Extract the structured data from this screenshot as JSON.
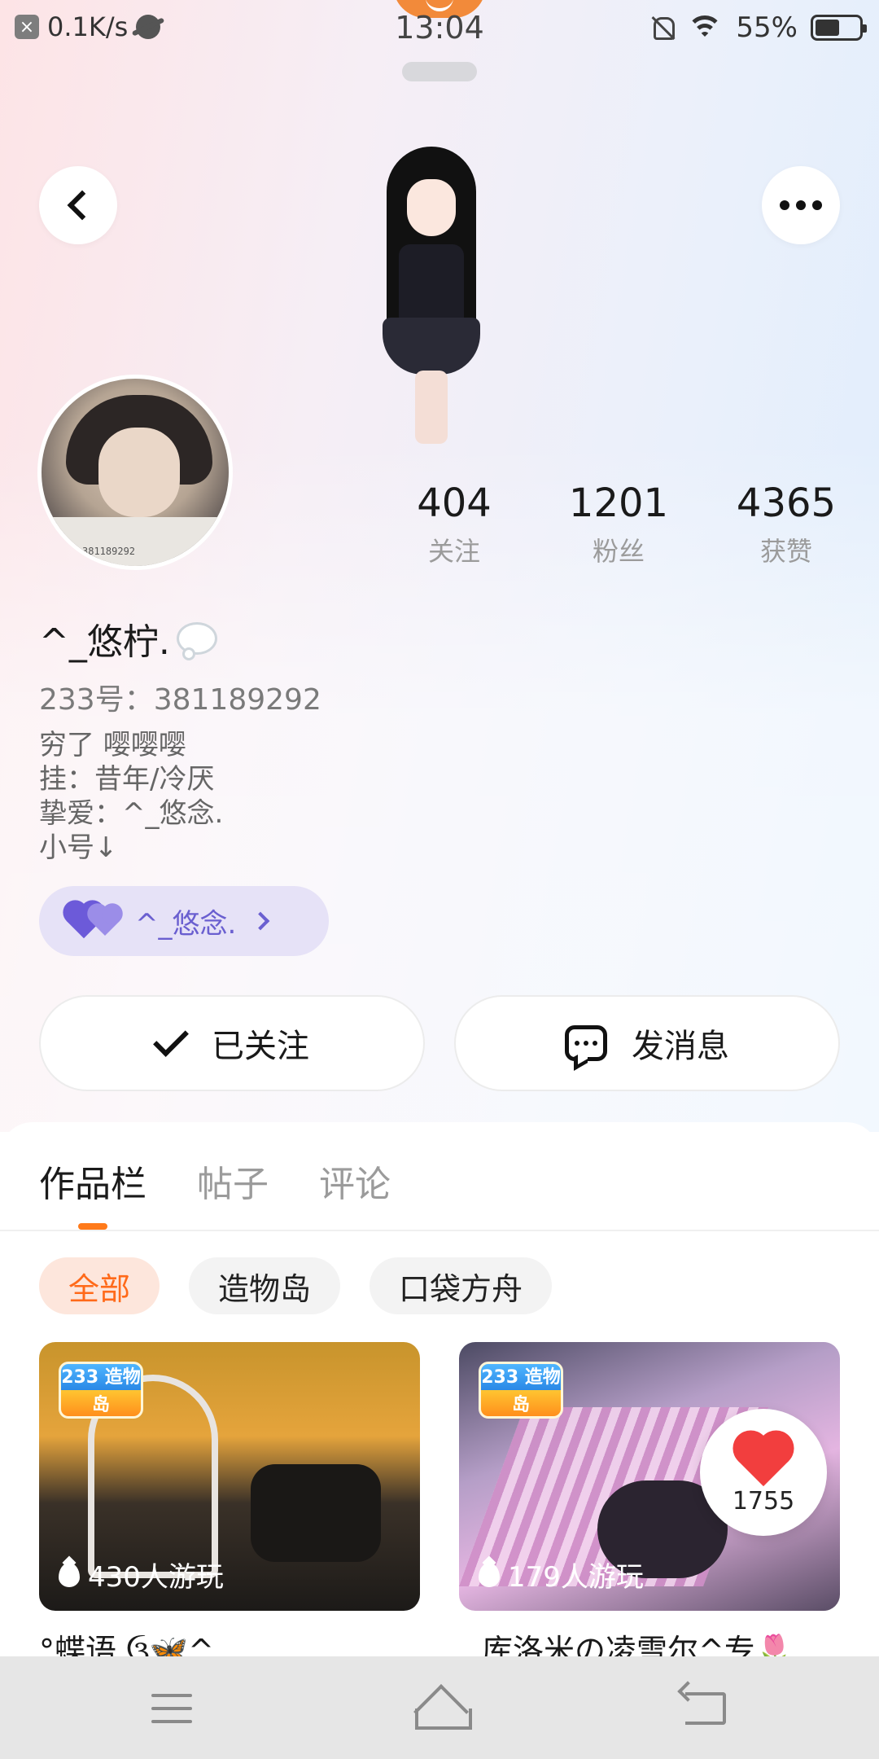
{
  "status_bar": {
    "net_speed": "0.1K/s",
    "time": "13:04",
    "battery": "55%",
    "battery_level": 0.55
  },
  "header": {
    "back_icon": "chevron-left-icon",
    "more_icon": "more-dots-icon"
  },
  "profile": {
    "stats": [
      {
        "value": "404",
        "label": "关注"
      },
      {
        "value": "1201",
        "label": "粉丝"
      },
      {
        "value": "4365",
        "label": "获赞"
      }
    ],
    "nickname": "^_悠柠.",
    "id_line": "233号：381189292",
    "bio": [
      "穷了 嘤嘤嘤",
      "挂：昔年/冷厌",
      "挚爱：^_悠念.",
      "小号↓"
    ],
    "avatar_caption": "381189292",
    "linked_user": "^_悠念."
  },
  "actions": {
    "followed_label": "已关注",
    "message_label": "发消息"
  },
  "tabs": [
    {
      "label": "作品栏",
      "active": true
    },
    {
      "label": "帖子",
      "active": false
    },
    {
      "label": "评论",
      "active": false
    }
  ],
  "filters": [
    {
      "label": "全部",
      "active": true
    },
    {
      "label": "造物岛",
      "active": false
    },
    {
      "label": "口袋方舟",
      "active": false
    }
  ],
  "games": [
    {
      "logo": "233 造物岛",
      "plays": "430人游玩",
      "title": "°蝶语.ઉ🦋^"
    },
    {
      "logo": "233 造物岛",
      "plays": "179人游玩",
      "title": "库洛米の凌雪尔^专🌷",
      "likes": "1755"
    }
  ],
  "colors": {
    "accent": "#ff7a1a",
    "link_chip_bg": "#e6e2f7",
    "link_chip_text": "#6a5fd0",
    "like_heart": "#f23e3e"
  }
}
